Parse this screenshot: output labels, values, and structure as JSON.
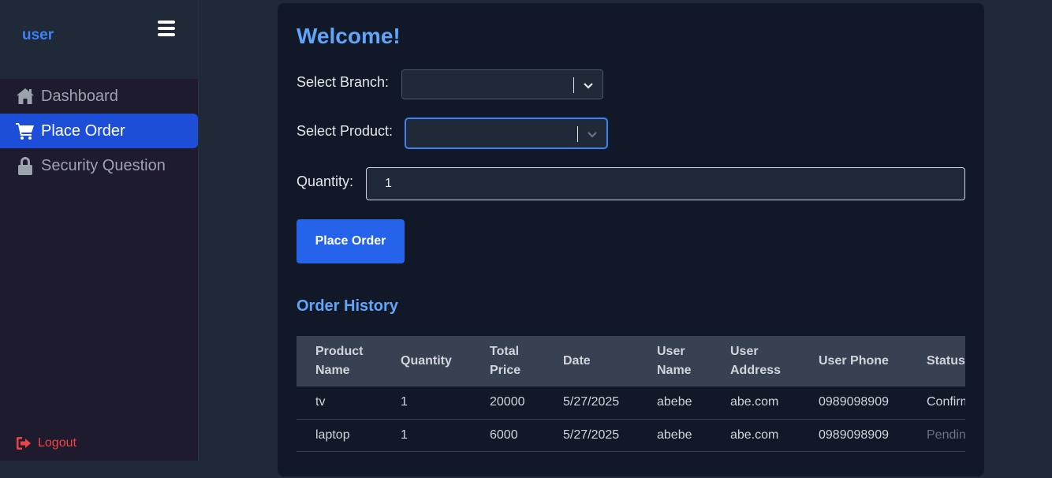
{
  "sidebar": {
    "brand": "user",
    "items": [
      {
        "label": "Dashboard",
        "icon": "home-icon"
      },
      {
        "label": "Place Order",
        "icon": "cart-icon",
        "active": true
      },
      {
        "label": "Security Question",
        "icon": "lock-icon"
      }
    ],
    "logout_label": "Logout"
  },
  "main": {
    "welcome": "Welcome!",
    "branch_label": "Select Branch:",
    "product_label": "Select Product:",
    "quantity_label": "Quantity:",
    "quantity_value": "1",
    "place_order_label": "Place Order",
    "history_title": "Order History"
  },
  "table": {
    "headers": [
      "Product Name",
      "Quantity",
      "Total Price",
      "Date",
      "User Name",
      "User Address",
      "User Phone",
      "Status"
    ],
    "rows": [
      [
        "tv",
        "1",
        "20000",
        "5/27/2025",
        "abebe",
        "abe.com",
        "0989098909",
        "Confirm"
      ],
      [
        "laptop",
        "1",
        "6000",
        "5/27/2025",
        "abebe",
        "abe.com",
        "0989098909",
        "Pendin"
      ]
    ]
  },
  "colors": {
    "accent": "#2563eb",
    "heading": "#60a5fa",
    "logout": "#ef4444"
  }
}
